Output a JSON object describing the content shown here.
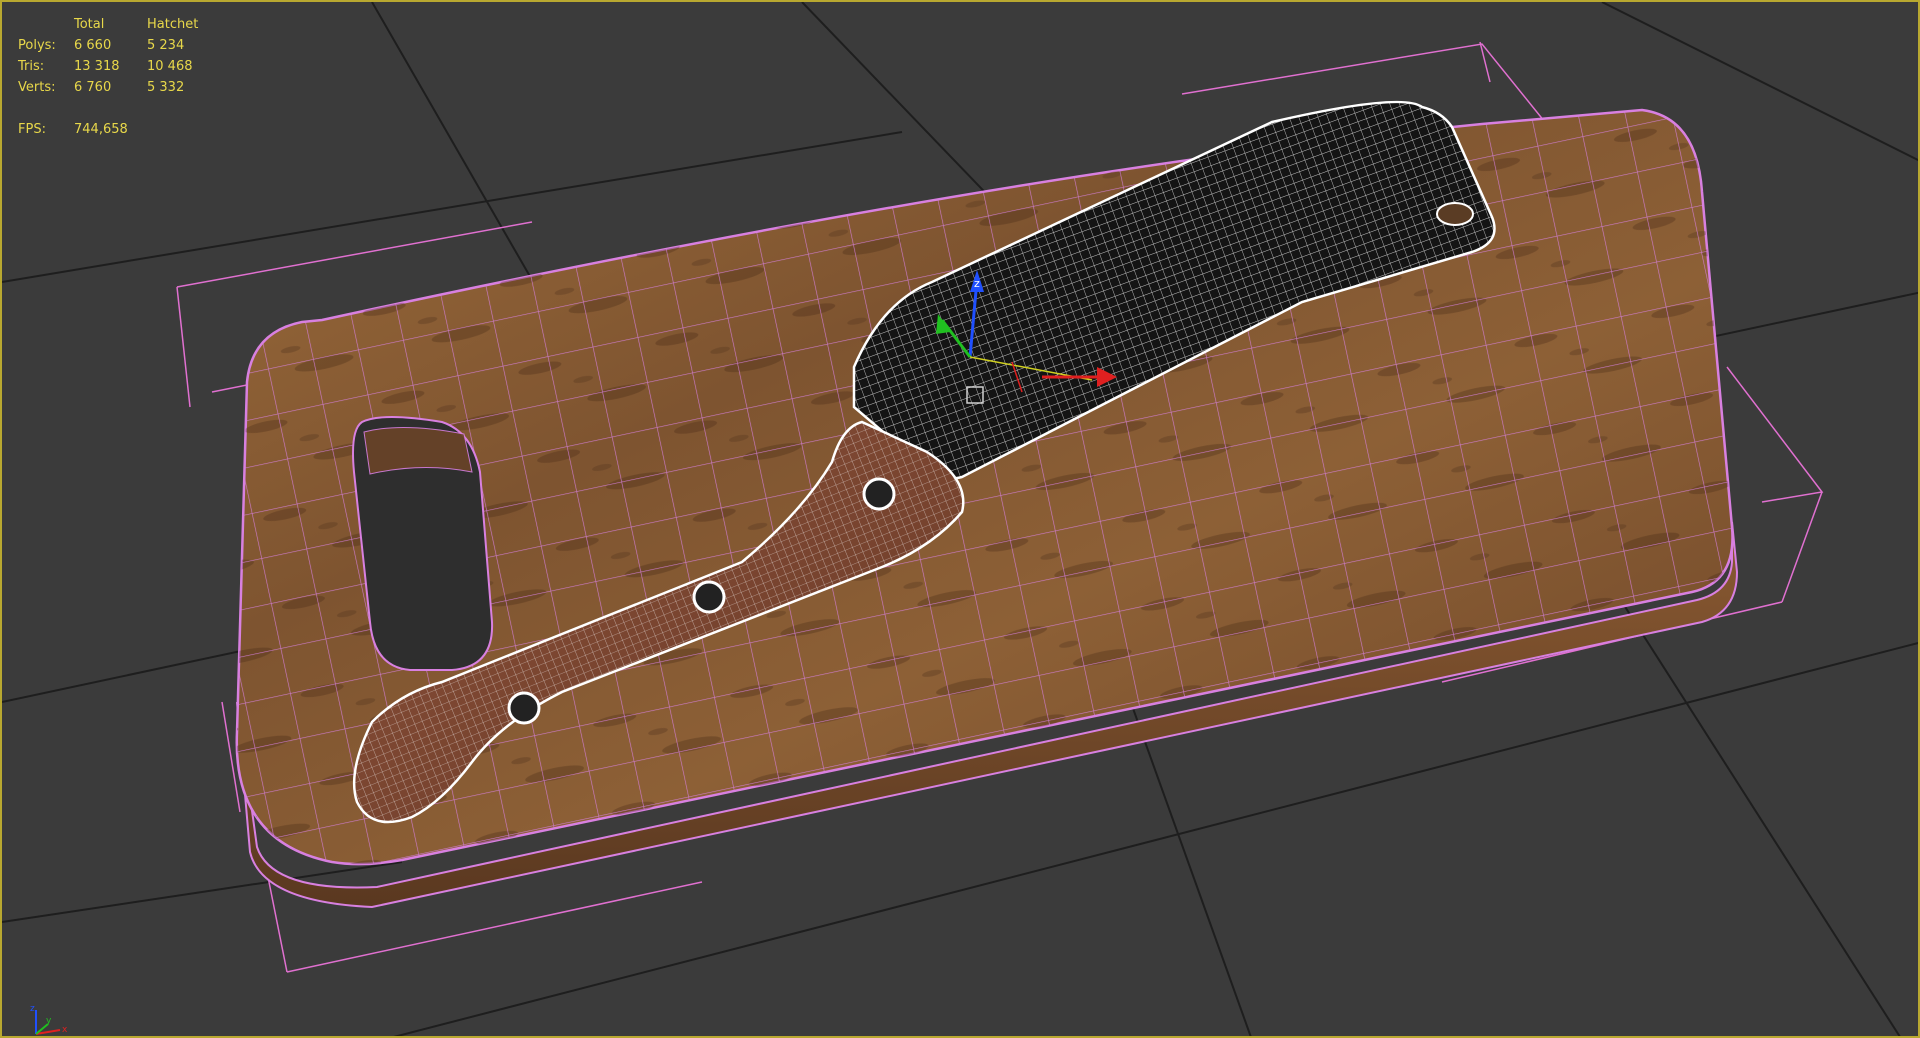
{
  "viewport": {
    "stats": {
      "headers": [
        "",
        "Total",
        "Hatchet"
      ],
      "rows": [
        {
          "label": "Polys:",
          "total": "6 660",
          "hatchet": "5 234"
        },
        {
          "label": "Tris:",
          "total": "13 318",
          "hatchet": "10 468"
        },
        {
          "label": "Verts:",
          "total": "6 760",
          "hatchet": "5 332"
        }
      ],
      "fps_label": "FPS:",
      "fps_value": "744,658"
    },
    "gizmo": {
      "z_label": "z"
    },
    "corner_axis": {
      "x_label": "x",
      "y_label": "y",
      "z_label": "z"
    }
  },
  "colors": {
    "viewport_bg": "#3b3b3b",
    "grid_line": "#1e1e1e",
    "active_border": "#b8a830",
    "stats_text": "#e8d84a",
    "board_wire": "#d880e0",
    "board_wood": "#8a5a32",
    "blade_fill": "#141414",
    "blade_wire": "#ffffff",
    "handle_wood": "#7a4530",
    "bbox_lines": "#e070d0",
    "axis_x": "#e02020",
    "axis_y": "#20c020",
    "axis_z": "#2050ff"
  },
  "icons": {
    "gizmo": "transform-gizmo-icon",
    "corner_axis": "world-axis-tripod-icon"
  }
}
